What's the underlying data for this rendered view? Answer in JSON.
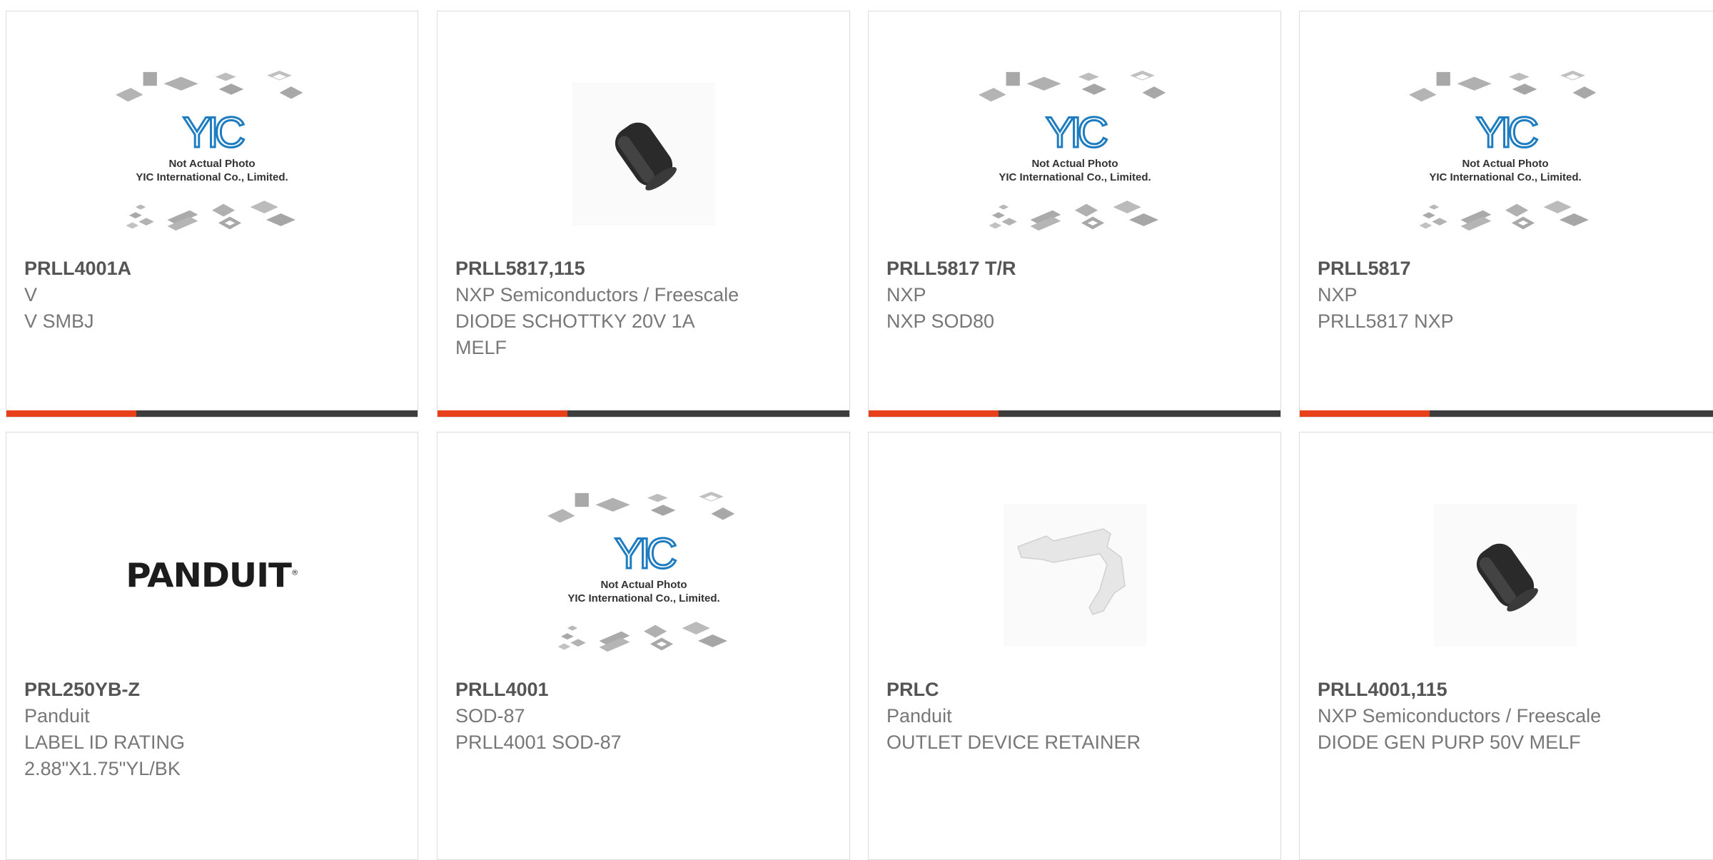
{
  "placeholder": {
    "line1": "Not Actual Photo",
    "line2": "YIC International Co., Limited.",
    "logo": "YIC"
  },
  "brand_logo": {
    "text": "PANDUIT",
    "mark": "®"
  },
  "colors": {
    "accent": "#e8401a",
    "bar": "#3d3d3d",
    "border": "#dcdcdc"
  },
  "products": [
    {
      "part": "PRLL4001A",
      "manufacturer": "V",
      "description": "V SMBJ",
      "image": "yic-placeholder"
    },
    {
      "part": "PRLL5817,115",
      "manufacturer": "NXP Semiconductors / Freescale",
      "description": "DIODE SCHOTTKY 20V 1A\nMELF",
      "image": "melf-diode"
    },
    {
      "part": "PRLL5817 T/R",
      "manufacturer": "NXP",
      "description": "NXP SOD80",
      "image": "yic-placeholder"
    },
    {
      "part": "PRLL5817",
      "manufacturer": "NXP",
      "description": "PRLL5817 NXP",
      "image": "yic-placeholder"
    },
    {
      "part": "PRL250YB-Z",
      "manufacturer": "Panduit",
      "description": "LABEL ID RATING\n2.88\"X1.75\"YL/BK",
      "image": "panduit-logo"
    },
    {
      "part": "PRLL4001",
      "manufacturer": "SOD-87",
      "description": "PRLL4001 SOD-87",
      "image": "yic-placeholder"
    },
    {
      "part": "PRLC",
      "manufacturer": "Panduit",
      "description": "OUTLET DEVICE RETAINER",
      "image": "outlet-retainer"
    },
    {
      "part": "PRLL4001,115",
      "manufacturer": "NXP Semiconductors / Freescale",
      "description": "DIODE GEN PURP 50V MELF",
      "image": "melf-diode"
    }
  ]
}
